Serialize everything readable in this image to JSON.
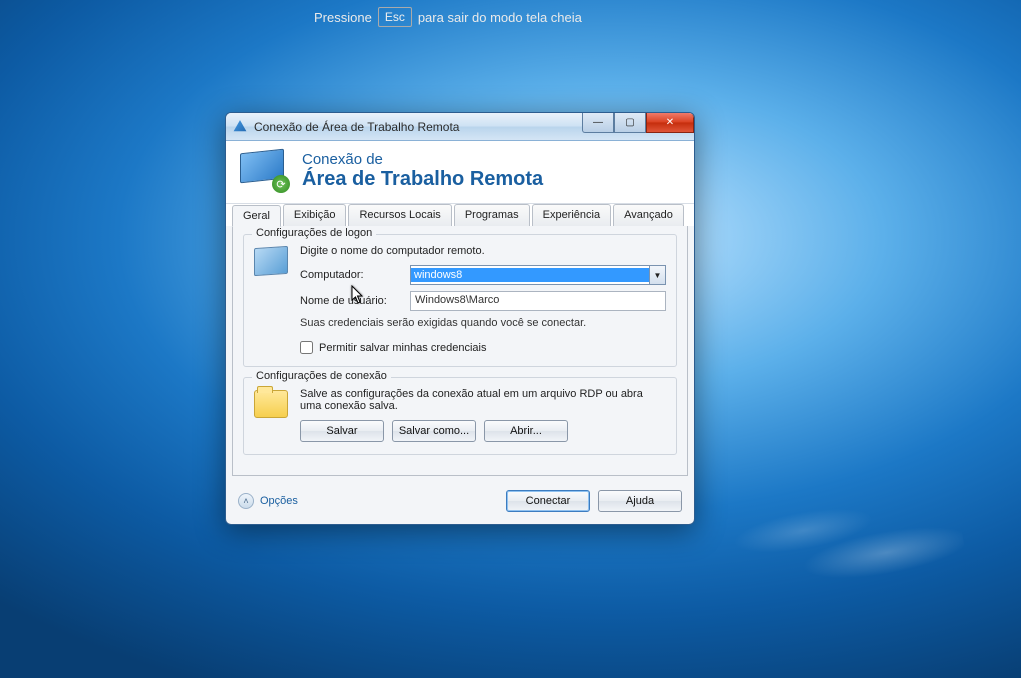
{
  "fullscreen_notice": {
    "before": "Pressione",
    "key": "Esc",
    "after": "para sair do modo tela cheia"
  },
  "window": {
    "title": "Conexão de Área de Trabalho Remota",
    "banner_line1": "Conexão de",
    "banner_line2": "Área de Trabalho Remota",
    "tabs": [
      {
        "label": "Geral"
      },
      {
        "label": "Exibição"
      },
      {
        "label": "Recursos Locais"
      },
      {
        "label": "Programas"
      },
      {
        "label": "Experiência"
      },
      {
        "label": "Avançado"
      }
    ],
    "logon_group": {
      "legend": "Configurações de logon",
      "instruction": "Digite o nome do computador remoto.",
      "computer_label": "Computador:",
      "computer_value": "windows8",
      "username_label": "Nome de usuário:",
      "username_value": "Windows8\\Marco",
      "credentials_note": "Suas credenciais serão exigidas quando você se conectar.",
      "allow_save_creds_label": "Permitir salvar minhas credenciais"
    },
    "connection_group": {
      "legend": "Configurações de conexão",
      "instruction": "Salve as configurações da conexão atual em um arquivo RDP ou abra uma conexão salva.",
      "save_label": "Salvar",
      "save_as_label": "Salvar como...",
      "open_label": "Abrir..."
    },
    "footer": {
      "options_label": "Opções",
      "connect_label": "Conectar",
      "help_label": "Ajuda"
    }
  }
}
